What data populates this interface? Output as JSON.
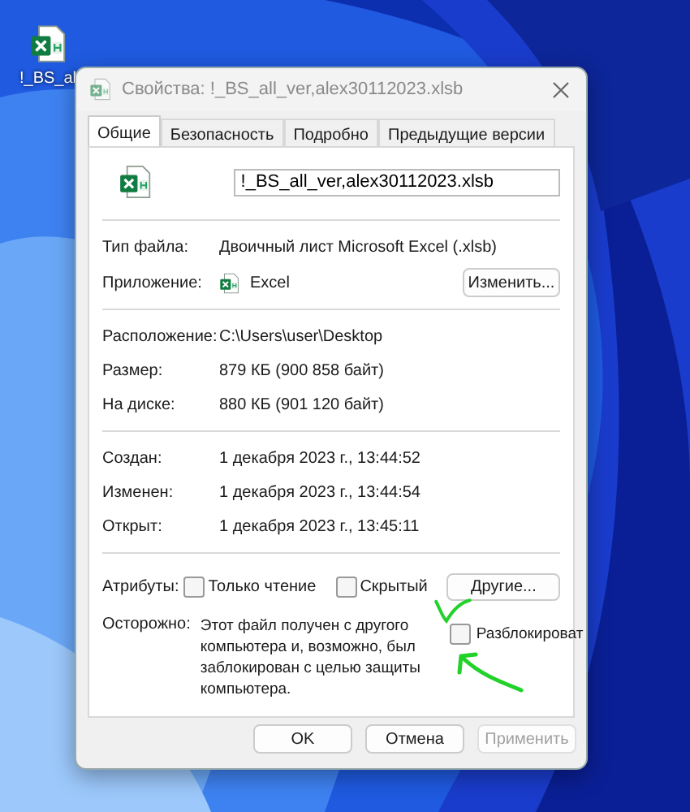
{
  "desktop": {
    "icons": [
      {
        "label": "!_BS_al"
      }
    ]
  },
  "dialog": {
    "title": "Свойства: !_BS_all_ver,alex30112023.xlsb",
    "tabs": [
      {
        "label": "Общие",
        "selected": true
      },
      {
        "label": "Безопасность",
        "selected": false
      },
      {
        "label": "Подробно",
        "selected": false
      },
      {
        "label": "Предыдущие версии",
        "selected": false
      }
    ],
    "file_name": "!_BS_all_ver,alex30112023.xlsb",
    "sections": [
      [
        {
          "kind": "text",
          "label": "Тип файла:",
          "value": "Двоичный лист Microsoft Excel (.xlsb)"
        },
        {
          "kind": "app",
          "label": "Приложение:",
          "value": "Excel",
          "button": "Изменить..."
        }
      ],
      [
        {
          "kind": "text",
          "label": "Расположение:",
          "value": "C:\\Users\\user\\Desktop"
        },
        {
          "kind": "text",
          "label": "Размер:",
          "value": "879 КБ (900 858 байт)"
        },
        {
          "kind": "text",
          "label": "На диске:",
          "value": "880 КБ (901 120 байт)"
        }
      ],
      [
        {
          "kind": "text",
          "label": "Создан:",
          "value": "1 декабря 2023 г., 13:44:52"
        },
        {
          "kind": "text",
          "label": "Изменен:",
          "value": "1 декабря 2023 г., 13:44:54"
        },
        {
          "kind": "text",
          "label": "Открыт:",
          "value": "1 декабря 2023 г., 13:45:11"
        }
      ]
    ],
    "attributes": {
      "label": "Атрибуты:",
      "options": [
        {
          "label": "Только чтение",
          "checked": false
        },
        {
          "label": "Скрытый",
          "checked": false
        }
      ],
      "button": "Другие..."
    },
    "warning": {
      "label": "Осторожно:",
      "text": "Этот файл получен с другого компьютера и, возможно, был заблокирован с целью защиты компьютера.",
      "unblock": {
        "label": "Разблокироват",
        "checked": false
      }
    },
    "buttons": [
      {
        "label": "OK",
        "disabled": false
      },
      {
        "label": "Отмена",
        "disabled": false
      },
      {
        "label": "Применить",
        "disabled": true
      }
    ]
  }
}
